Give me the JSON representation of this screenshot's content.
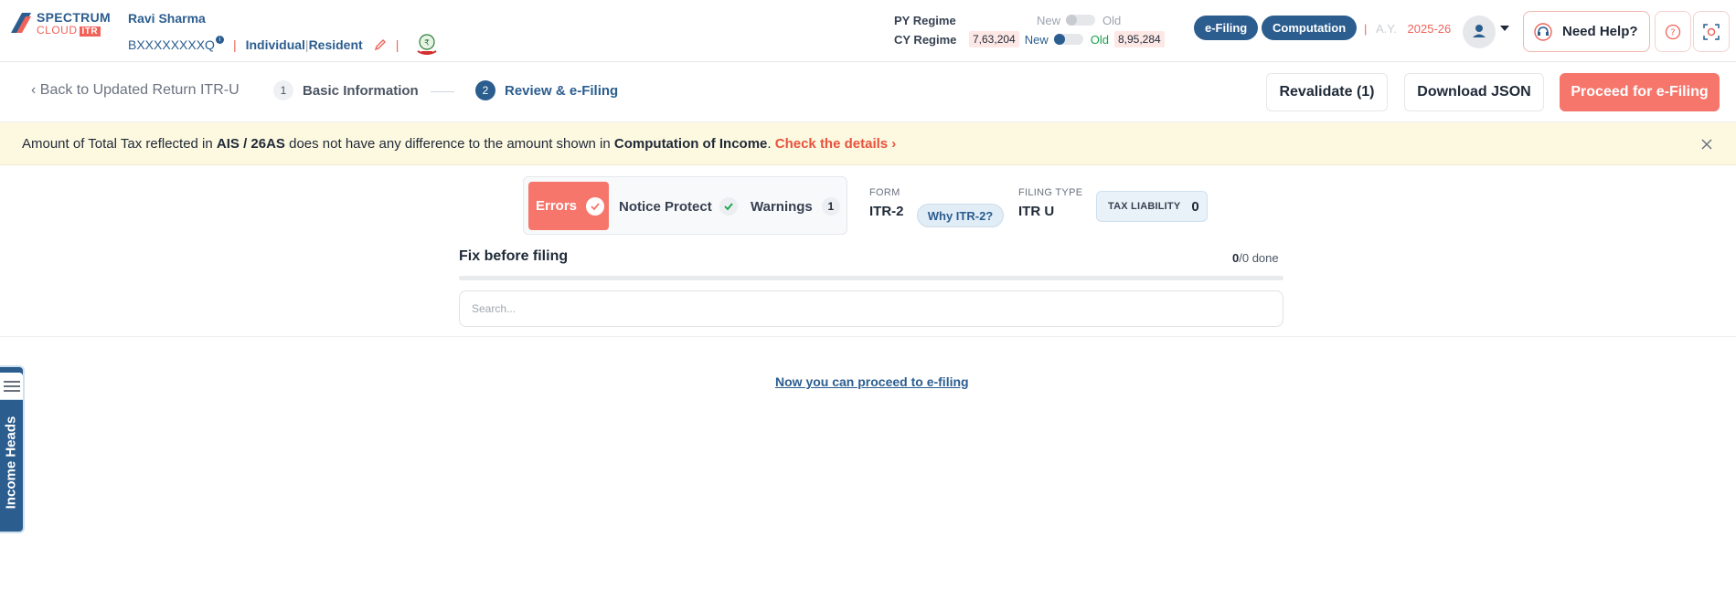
{
  "brand": {
    "line1": "SPECTRUM",
    "line2": "CLOUD",
    "badge": "ITR",
    "primary_color": "#2b5d8f",
    "accent_color": "#f0625a"
  },
  "user": {
    "name": "Ravi Sharma",
    "pan": "BXXXXXXXXQ",
    "info_marker": "i",
    "category": "Individual",
    "residency": "Resident",
    "separator": "|"
  },
  "regime": {
    "py_label": "PY Regime",
    "cy_label": "CY Regime",
    "new_label": "New",
    "old_label": "Old",
    "cy_new_amount": "7,63,204",
    "cy_old_amount": "8,95,284"
  },
  "header_buttons": {
    "efiling": "e-Filing",
    "computation": "Computation"
  },
  "assessment_year": {
    "label": "A.Y.",
    "value": "2025-26"
  },
  "help": {
    "label": "Need Help?"
  },
  "stepper": {
    "back_label": "‹ Back to Updated Return ITR-U",
    "steps": [
      {
        "number": "1",
        "label": "Basic Information"
      },
      {
        "number": "2",
        "label": "Review & e-Filing"
      }
    ]
  },
  "actions": {
    "revalidate": "Revalidate (1)",
    "download_json": "Download JSON",
    "proceed": "Proceed for e-Filing"
  },
  "banner": {
    "part1": "Amount of Total Tax reflected in ",
    "bold1": "AIS / 26AS",
    "part2": " does not have any difference to the amount shown in ",
    "bold2": "Computation of Income",
    "part3": ". ",
    "link": "Check the details ›"
  },
  "tabs": {
    "errors": "Errors",
    "notice_protect": "Notice Protect",
    "warnings": "Warnings",
    "warnings_count": "1"
  },
  "form_info": {
    "form_label": "FORM",
    "form_value": "ITR-2",
    "why_label": "Why ITR-2?",
    "filing_type_label": "FILING TYPE",
    "filing_type_value": "ITR U",
    "tax_liability_label": "TAX LIABILITY",
    "tax_liability_value": "0"
  },
  "fix_section": {
    "title": "Fix before filing",
    "done_count": "0",
    "total_suffix": "/0 done",
    "progress": 0,
    "search_placeholder": "Search..."
  },
  "proceed_message": "Now you can proceed to e-filing",
  "side_tab": {
    "label": "Income Heads"
  }
}
